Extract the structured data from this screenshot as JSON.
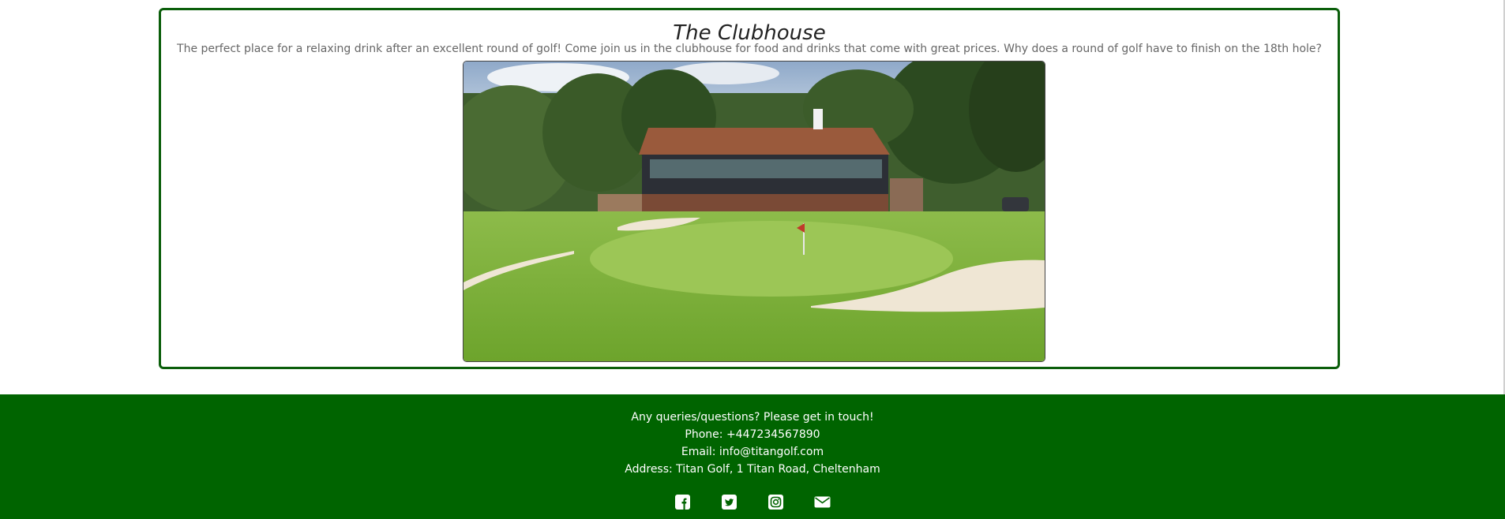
{
  "clubhouse": {
    "title": "The Clubhouse",
    "description": "The perfect place for a relaxing drink after an excellent round of golf! Come join us in the clubhouse for food and drinks that come with great prices. Why does a round of golf have to finish on the 18th hole?"
  },
  "footer": {
    "intro": "Any queries/questions? Please get in touch!",
    "phone": "Phone: +447234567890",
    "email": "Email: info@titangolf.com",
    "address": "Address: Titan Golf, 1 Titan Road, Cheltenham",
    "social": [
      {
        "name": "facebook-icon"
      },
      {
        "name": "twitter-icon"
      },
      {
        "name": "instagram-icon"
      },
      {
        "name": "envelope-icon"
      }
    ]
  },
  "colors": {
    "brand_green": "#006400",
    "card_border": "#0b5e0b"
  }
}
